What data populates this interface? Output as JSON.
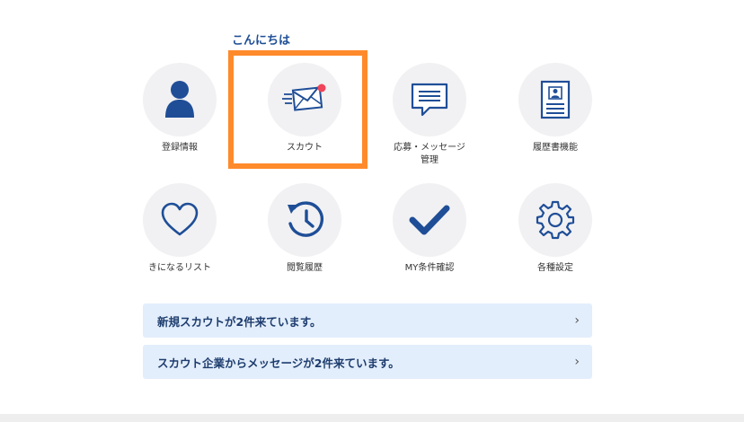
{
  "greeting": "こんにちは",
  "menu": [
    {
      "label": "登録情報",
      "icon": "person-icon"
    },
    {
      "label": "スカウト",
      "icon": "envelope-icon",
      "badge": true
    },
    {
      "label": "応募・メッセージ\n管理",
      "icon": "chat-bubble-icon"
    },
    {
      "label": "履歴書機能",
      "icon": "resume-icon"
    },
    {
      "label": "きになるリスト",
      "icon": "heart-icon"
    },
    {
      "label": "閲覧履歴",
      "icon": "history-icon"
    },
    {
      "label": "MY条件確認",
      "icon": "checkmark-icon"
    },
    {
      "label": "各種設定",
      "icon": "gear-icon"
    }
  ],
  "notices": [
    {
      "text": "新規スカウトが2件来ています。",
      "chevron": "›"
    },
    {
      "text": "スカウト企業からメッセージが2件来ています。",
      "chevron": "›"
    }
  ],
  "colors": {
    "accent": "#1e4f96",
    "icon": "#1f4e97",
    "highlight": "#ff8a2b",
    "badge": "#f0445a",
    "notice_bg": "#e3eefc"
  }
}
